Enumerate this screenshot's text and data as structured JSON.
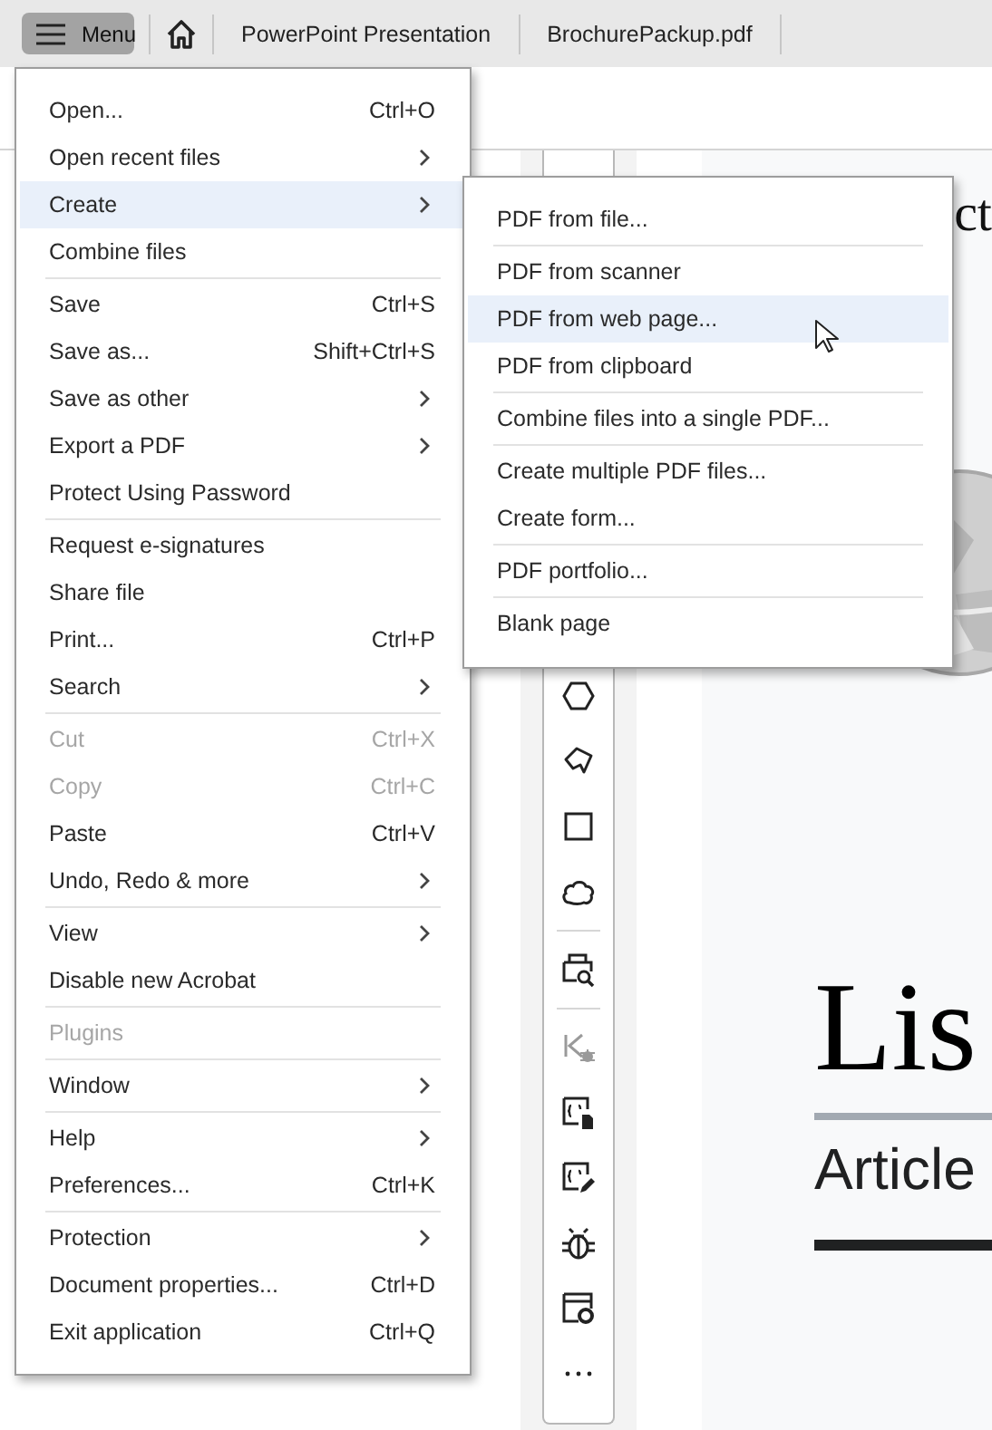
{
  "tabbar": {
    "menu_button": {
      "label": "Menu"
    },
    "tabs": [
      {
        "label": "PowerPoint Presentation"
      },
      {
        "label": "BrochurePackup.pdf"
      }
    ]
  },
  "menu": {
    "groups": [
      [
        {
          "label": "Open...",
          "shortcut": "Ctrl+O",
          "submenu": false,
          "disabled": false,
          "selected": false
        },
        {
          "label": "Open recent files",
          "submenu": true,
          "disabled": false,
          "selected": false
        },
        {
          "label": "Create",
          "submenu": true,
          "disabled": false,
          "selected": true
        },
        {
          "label": "Combine files",
          "submenu": false,
          "disabled": false,
          "selected": false
        }
      ],
      [
        {
          "label": "Save",
          "shortcut": "Ctrl+S",
          "submenu": false,
          "disabled": false,
          "selected": false
        },
        {
          "label": "Save as...",
          "shortcut": "Shift+Ctrl+S",
          "submenu": false,
          "disabled": false,
          "selected": false
        },
        {
          "label": "Save as other",
          "submenu": true,
          "disabled": false,
          "selected": false
        },
        {
          "label": "Export a PDF",
          "submenu": true,
          "disabled": false,
          "selected": false
        },
        {
          "label": "Protect Using Password",
          "submenu": false,
          "disabled": false,
          "selected": false
        }
      ],
      [
        {
          "label": "Request e-signatures",
          "submenu": false,
          "disabled": false,
          "selected": false
        },
        {
          "label": "Share file",
          "submenu": false,
          "disabled": false,
          "selected": false
        },
        {
          "label": "Print...",
          "shortcut": "Ctrl+P",
          "submenu": false,
          "disabled": false,
          "selected": false
        },
        {
          "label": "Search",
          "submenu": true,
          "disabled": false,
          "selected": false
        }
      ],
      [
        {
          "label": "Cut",
          "shortcut": "Ctrl+X",
          "submenu": false,
          "disabled": true,
          "selected": false
        },
        {
          "label": "Copy",
          "shortcut": "Ctrl+C",
          "submenu": false,
          "disabled": true,
          "selected": false
        },
        {
          "label": "Paste",
          "shortcut": "Ctrl+V",
          "submenu": false,
          "disabled": false,
          "selected": false
        },
        {
          "label": "Undo, Redo & more",
          "submenu": true,
          "disabled": false,
          "selected": false
        }
      ],
      [
        {
          "label": "View",
          "submenu": true,
          "disabled": false,
          "selected": false
        },
        {
          "label": "Disable new Acrobat",
          "submenu": false,
          "disabled": false,
          "selected": false
        }
      ],
      [
        {
          "label": "Plugins",
          "submenu": false,
          "disabled": true,
          "selected": false
        }
      ],
      [
        {
          "label": "Window",
          "submenu": true,
          "disabled": false,
          "selected": false
        }
      ],
      [
        {
          "label": "Help",
          "submenu": true,
          "disabled": false,
          "selected": false
        },
        {
          "label": "Preferences...",
          "shortcut": "Ctrl+K",
          "submenu": false,
          "disabled": false,
          "selected": false
        }
      ],
      [
        {
          "label": "Protection",
          "submenu": true,
          "disabled": false,
          "selected": false
        },
        {
          "label": "Document properties...",
          "shortcut": "Ctrl+D",
          "submenu": false,
          "disabled": false,
          "selected": false
        },
        {
          "label": "Exit application",
          "shortcut": "Ctrl+Q",
          "submenu": false,
          "disabled": false,
          "selected": false
        }
      ]
    ]
  },
  "submenu": {
    "groups": [
      [
        {
          "label": "PDF from file...",
          "selected": false
        }
      ],
      [
        {
          "label": "PDF from scanner",
          "selected": false
        },
        {
          "label": "PDF from web page...",
          "selected": true
        },
        {
          "label": "PDF from clipboard",
          "selected": false
        }
      ],
      [
        {
          "label": "Combine files into a single PDF...",
          "selected": false
        }
      ],
      [
        {
          "label": "Create multiple PDF files...",
          "selected": false
        },
        {
          "label": "Create form...",
          "selected": false
        }
      ],
      [
        {
          "label": "PDF portfolio...",
          "selected": false
        }
      ],
      [
        {
          "label": "Blank page",
          "selected": false
        }
      ]
    ]
  },
  "toolbar": {
    "tools": [
      {
        "kind": "hexagon",
        "disabled": false
      },
      {
        "kind": "polygon",
        "disabled": false
      },
      {
        "kind": "square",
        "disabled": false
      },
      {
        "kind": "cloud",
        "disabled": false
      },
      {
        "kind": "divider"
      },
      {
        "kind": "print-preview",
        "disabled": false
      },
      {
        "kind": "divider"
      },
      {
        "kind": "debug-start",
        "disabled": true
      },
      {
        "kind": "script-page",
        "disabled": false
      },
      {
        "kind": "script-edit",
        "disabled": false
      },
      {
        "kind": "bug",
        "disabled": false
      },
      {
        "kind": "window-gear",
        "disabled": false
      },
      {
        "kind": "more",
        "disabled": false
      }
    ]
  },
  "document": {
    "heading_fragment": "ct",
    "title_fragment": "Lis",
    "subtitle_fragment": "Article"
  }
}
